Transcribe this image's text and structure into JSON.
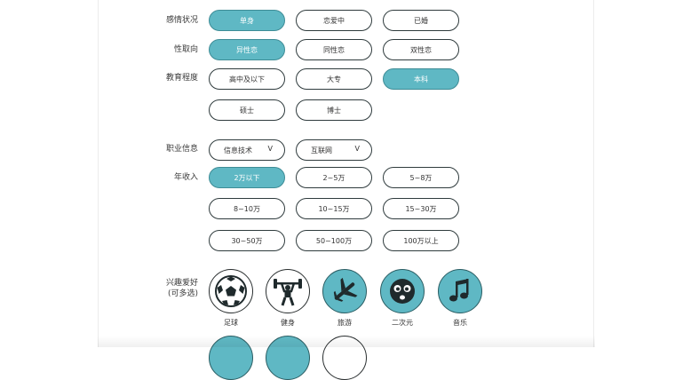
{
  "form": {
    "relationship": {
      "label": "感情状况",
      "options": [
        {
          "text": "单身",
          "selected": true
        },
        {
          "text": "恋爱中",
          "selected": false
        },
        {
          "text": "已婚",
          "selected": false
        }
      ]
    },
    "orientation": {
      "label": "性取向",
      "options": [
        {
          "text": "异性恋",
          "selected": true
        },
        {
          "text": "同性恋",
          "selected": false
        },
        {
          "text": "双性恋",
          "selected": false
        }
      ]
    },
    "education": {
      "label": "教育程度",
      "options": [
        {
          "text": "高中及以下",
          "selected": false
        },
        {
          "text": "大专",
          "selected": false
        },
        {
          "text": "本科",
          "selected": true
        },
        {
          "text": "硕士",
          "selected": false
        },
        {
          "text": "博士",
          "selected": false
        }
      ]
    },
    "occupation": {
      "label": "职业信息",
      "industry": "信息技术",
      "field": "互联网",
      "chevron": "V"
    },
    "income": {
      "label": "年收入",
      "options": [
        {
          "text": "2万以下",
          "selected": true
        },
        {
          "text": "2~5万",
          "selected": false
        },
        {
          "text": "5~8万",
          "selected": false
        },
        {
          "text": "8~10万",
          "selected": false
        },
        {
          "text": "10~15万",
          "selected": false
        },
        {
          "text": "15~30万",
          "selected": false
        },
        {
          "text": "30~50万",
          "selected": false
        },
        {
          "text": "50~100万",
          "selected": false
        },
        {
          "text": "100万以上",
          "selected": false
        }
      ]
    },
    "hobbies": {
      "label": "兴趣爱好",
      "sublabel": "(可多选)",
      "items": [
        {
          "text": "足球",
          "icon": "soccer-ball-icon",
          "selected": false
        },
        {
          "text": "健身",
          "icon": "weightlifter-icon",
          "selected": false
        },
        {
          "text": "旅游",
          "icon": "airplane-icon",
          "selected": true
        },
        {
          "text": "二次元",
          "icon": "anime-face-icon",
          "selected": true
        },
        {
          "text": "音乐",
          "icon": "music-note-icon",
          "selected": true
        }
      ]
    }
  },
  "colors": {
    "accent": "#5fb8c4",
    "accent_border": "#3e8c96",
    "border": "#2f3b3d",
    "icon_dark": "#1f2a2c"
  }
}
